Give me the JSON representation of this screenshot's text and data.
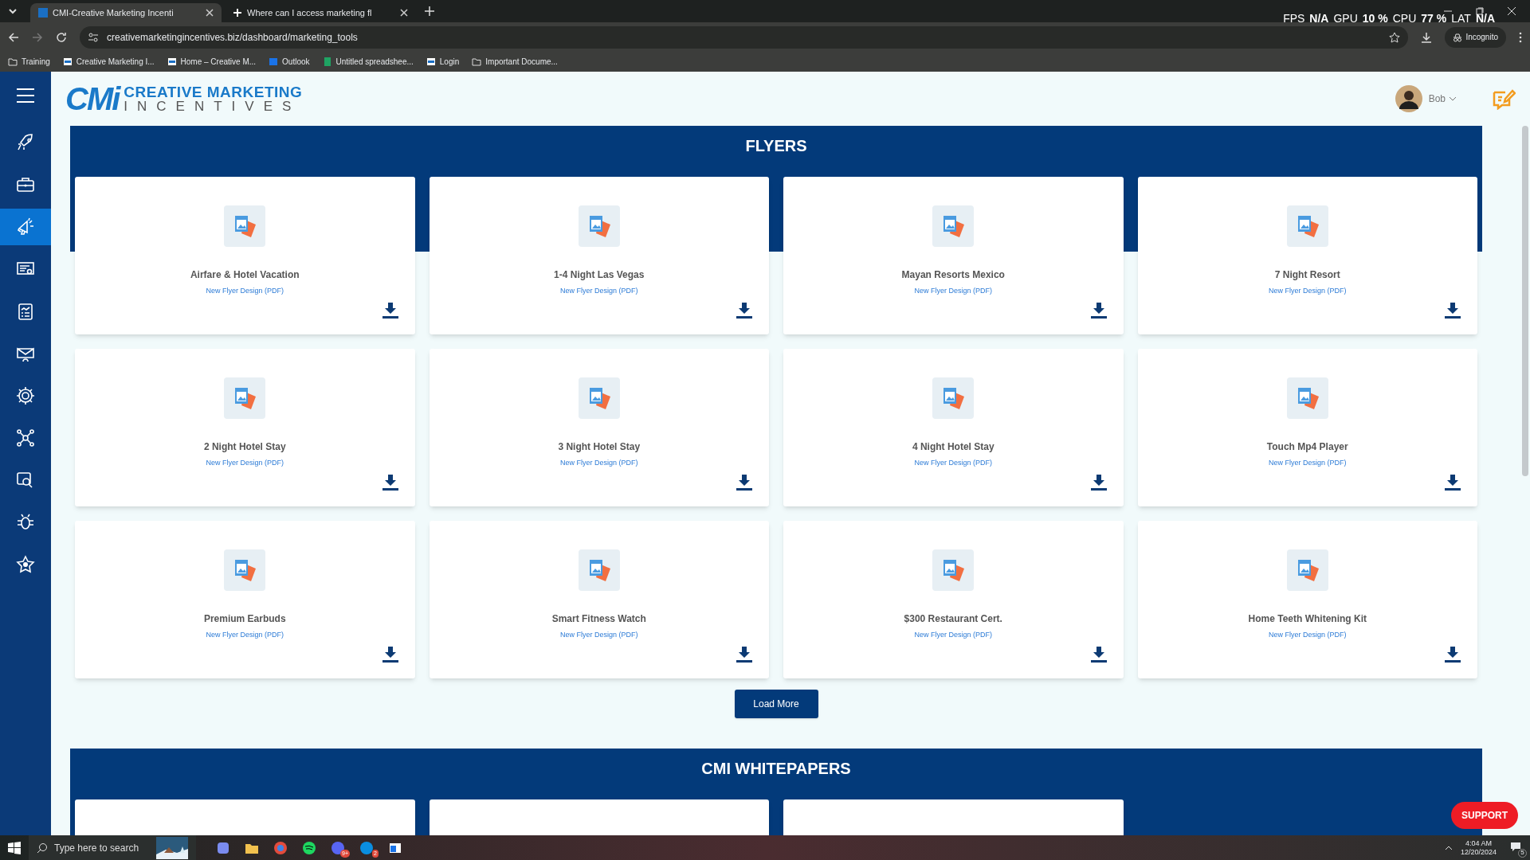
{
  "browser": {
    "tabs": [
      {
        "title": "CMI-Creative Marketing Incenti",
        "selected": true
      },
      {
        "title": "Where can I access marketing fl",
        "selected": false
      }
    ],
    "url": "creativemarketingincentives.biz/dashboard/marketing_tools",
    "incognito": "Incognito",
    "bookmarks": [
      "Training",
      "Creative Marketing I...",
      "Home – Creative M...",
      "Outlook",
      "Untitled spreadshee...",
      "Login",
      "Important Docume..."
    ],
    "overlay": [
      {
        "label": "FPS",
        "value": "N/A"
      },
      {
        "label": "GPU",
        "value": "10 %"
      },
      {
        "label": "CPU",
        "value": "77 %"
      },
      {
        "label": "LAT",
        "value": "N/A"
      }
    ]
  },
  "sidebar": {
    "items": [
      {
        "selected": false
      },
      {
        "selected": false
      },
      {
        "selected": true
      },
      {
        "selected": false
      },
      {
        "selected": false
      },
      {
        "selected": false
      },
      {
        "selected": false
      },
      {
        "selected": false
      },
      {
        "selected": false
      },
      {
        "selected": false
      },
      {
        "selected": false
      }
    ]
  },
  "header": {
    "logo_mark": "CMi",
    "logo_line_1": "CREATIVE MARKETING",
    "logo_line_2": "INCENTIVES",
    "user": "Bob"
  },
  "sections": [
    {
      "title": "FLYERS",
      "cards": [
        {
          "title": "Airfare & Hotel Vacation",
          "subtitle": "New Flyer Design (PDF)"
        },
        {
          "title": "1-4 Night Las Vegas",
          "subtitle": "New Flyer Design (PDF)"
        },
        {
          "title": "Mayan Resorts Mexico",
          "subtitle": "New Flyer Design (PDF)"
        },
        {
          "title": "7 Night Resort",
          "subtitle": "New Flyer Design (PDF)"
        },
        {
          "title": "2 Night Hotel Stay",
          "subtitle": "New Flyer Design (PDF)"
        },
        {
          "title": "3 Night Hotel Stay",
          "subtitle": "New Flyer Design (PDF)"
        },
        {
          "title": "4 Night Hotel Stay",
          "subtitle": "New Flyer Design (PDF)"
        },
        {
          "title": "Touch Mp4 Player",
          "subtitle": "New Flyer Design (PDF)"
        },
        {
          "title": "Premium Earbuds",
          "subtitle": "New Flyer Design (PDF)"
        },
        {
          "title": "Smart Fitness Watch",
          "subtitle": "New Flyer Design (PDF)"
        },
        {
          "title": "$300 Restaurant Cert.",
          "subtitle": "New Flyer Design (PDF)"
        },
        {
          "title": "Home Teeth Whitening Kit",
          "subtitle": "New Flyer Design (PDF)"
        }
      ],
      "button": "Load More"
    },
    {
      "title": "CMI WHITEPAPERS",
      "cards": [
        {
          "kind": "blank"
        },
        {
          "kind": "blank"
        },
        {
          "kind": "blank"
        }
      ]
    }
  ],
  "support": "SUPPORT",
  "taskbar": {
    "search": "Type here to search",
    "badges": [
      "9+",
      "2"
    ],
    "time": "4:04 AM",
    "date": "12/20/2024",
    "notifications": "5"
  }
}
